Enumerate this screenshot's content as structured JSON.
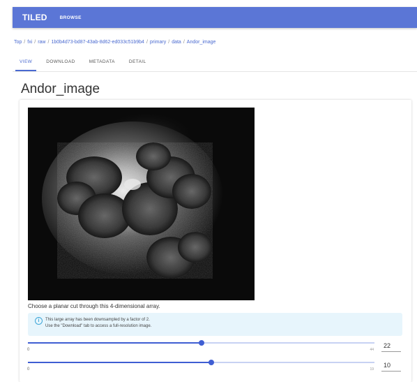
{
  "app": {
    "title": "TILED",
    "browse_label": "BROWSE",
    "accent_color": "#5b76d6"
  },
  "breadcrumb": {
    "items": [
      "Top",
      "fxi",
      "raw",
      "1b0b4d73-bd87-43ab-8d62-ed033c51b9b4",
      "primary",
      "data",
      "Andor_image"
    ],
    "separator": "/"
  },
  "tabs": [
    {
      "label": "VIEW",
      "active": true
    },
    {
      "label": "DOWNLOAD",
      "active": false
    },
    {
      "label": "METADATA",
      "active": false
    },
    {
      "label": "DETAIL",
      "active": false
    }
  ],
  "page": {
    "title": "Andor_image",
    "caption": "Choose a planar cut through this 4-dimensional array."
  },
  "alert": {
    "icon": "info-icon",
    "line1": "This large array has been downsampled by a factor of 2.",
    "line2": "Use the \"Download\" tab to access a full-resolution image."
  },
  "sliders": [
    {
      "min": "0",
      "max": "44",
      "value": "22",
      "fraction": 0.5
    },
    {
      "min": "0",
      "max": "19",
      "value": "10",
      "fraction": 0.53
    }
  ]
}
